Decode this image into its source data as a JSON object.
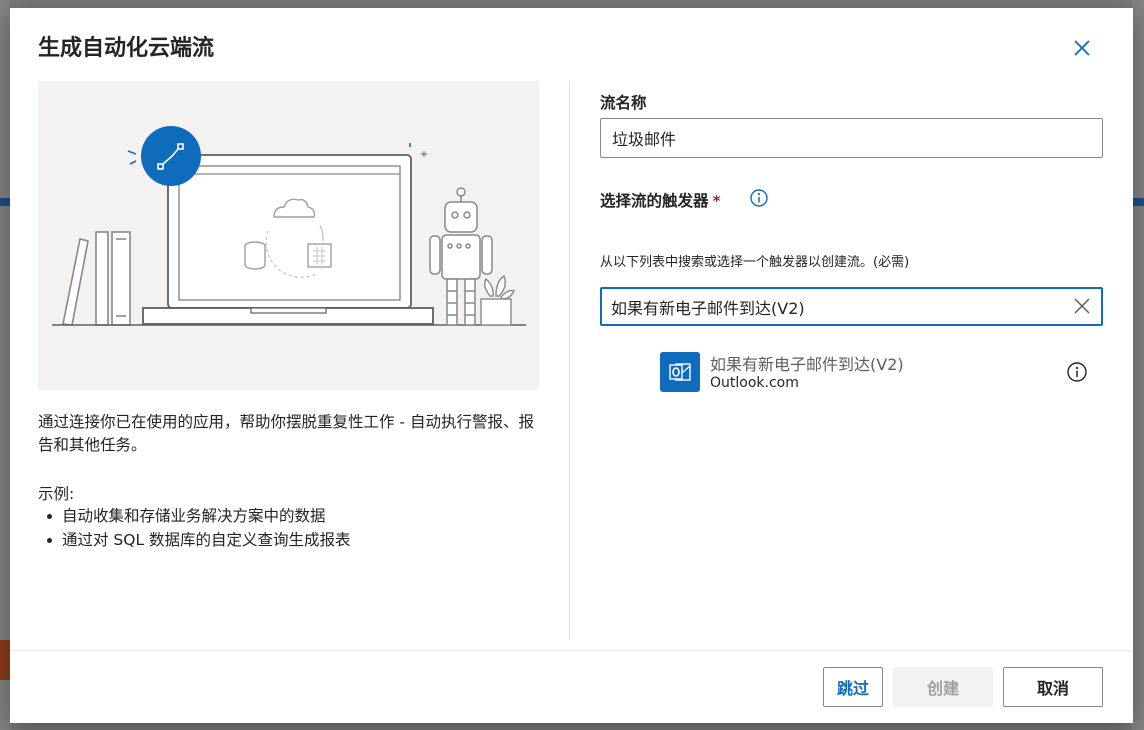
{
  "dialog": {
    "title": "生成自动化云端流",
    "description": "通过连接你已在使用的应用，帮助你摆脱重复性工作 - 自动执行警报、报告和其他任务。",
    "examples_title": "示例:",
    "examples": [
      "自动收集和存储业务解决方案中的数据",
      "通过对 SQL 数据库的自定义查询生成报表"
    ]
  },
  "form": {
    "flow_name_label": "流名称",
    "flow_name_value": "垃圾邮件",
    "trigger_label": "选择流的触发器",
    "required_mark": "*",
    "trigger_hint": "从以下列表中搜索或选择一个触发器以创建流。(必需)",
    "search_value": "如果有新电子邮件到达(V2)"
  },
  "results": [
    {
      "name": "如果有新电子邮件到达(V2)",
      "connector": "Outlook.com",
      "icon": "outlook-icon"
    }
  ],
  "buttons": {
    "skip": "跳过",
    "create": "创建",
    "cancel": "取消"
  },
  "colors": {
    "accent": "#0f6cbd",
    "required": "#a4262c",
    "illustration_bg": "#f3f2f1"
  }
}
